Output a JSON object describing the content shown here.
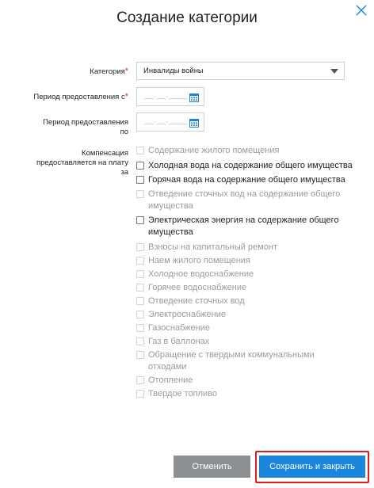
{
  "dialog": {
    "title": "Создание категории"
  },
  "form": {
    "category": {
      "label": "Категория",
      "required_mark": "*",
      "value": "Инвалиды войны"
    },
    "period_from": {
      "label": "Период предоставления с",
      "required_mark": "*",
      "placeholder": "__.__.____"
    },
    "period_to": {
      "label_line1": "Период предоставления",
      "label_line2": "по",
      "placeholder": "__.__.____"
    },
    "compensation": {
      "label_line1": "Компенсация",
      "label_line2": "предоставляется на плату",
      "label_line3": "за",
      "options": [
        {
          "label": "Содержание жилого помещения",
          "enabled": false,
          "checked": false
        },
        {
          "label": "Холодная вода на содержание общего имущества",
          "enabled": true,
          "checked": false
        },
        {
          "label": "Горячая вода на содержание общего имущества",
          "enabled": true,
          "checked": false
        },
        {
          "label": "Отведение сточных вод на содержание общего имущества",
          "enabled": false,
          "checked": false
        },
        {
          "label": "Электрическая энергия на содержание общего имущества",
          "enabled": true,
          "checked": false
        },
        {
          "label": "Взносы на капитальный ремонт",
          "enabled": false,
          "checked": false
        },
        {
          "label": "Наем жилого помещения",
          "enabled": false,
          "checked": false
        },
        {
          "label": "Холодное водоснабжение",
          "enabled": false,
          "checked": false
        },
        {
          "label": "Горячее водоснабжение",
          "enabled": false,
          "checked": false
        },
        {
          "label": "Отведение сточных вод",
          "enabled": false,
          "checked": false
        },
        {
          "label": "Электроснабжение",
          "enabled": false,
          "checked": false
        },
        {
          "label": "Газоснабжение",
          "enabled": false,
          "checked": false
        },
        {
          "label": "Газ в баллонах",
          "enabled": false,
          "checked": false
        },
        {
          "label": "Обращение с твердыми коммунальными отходами",
          "enabled": false,
          "checked": false
        },
        {
          "label": "Отопление",
          "enabled": false,
          "checked": false
        },
        {
          "label": "Твердое топливо",
          "enabled": false,
          "checked": false
        }
      ]
    }
  },
  "buttons": {
    "cancel": "Отменить",
    "save_close": "Сохранить и закрыть"
  },
  "colors": {
    "primary": "#1a86dd",
    "secondary": "#8c9092",
    "required": "#d9302c",
    "highlight": "#e01b1b"
  },
  "icons": {
    "close": "close-icon",
    "calendar": "calendar-icon",
    "dropdown": "chevron-down-icon"
  }
}
